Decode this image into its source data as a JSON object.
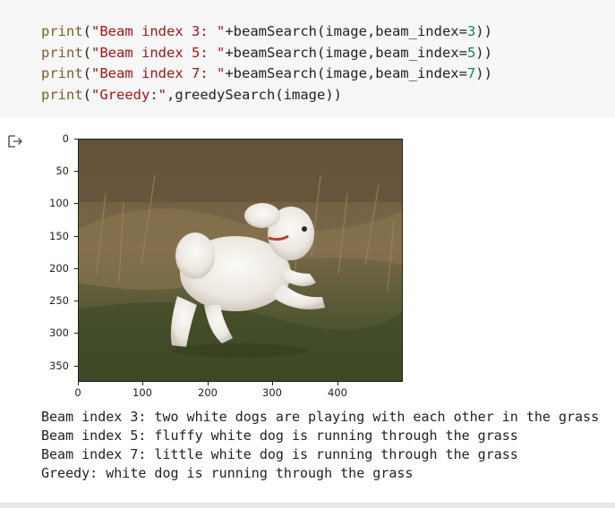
{
  "code": {
    "lines": [
      {
        "fn": "print",
        "open": "(",
        "str": "\"Beam index 3: \"",
        "rest1": "+beamSearch(image,beam_index=",
        "num": "3",
        "close": "))"
      },
      {
        "fn": "print",
        "open": "(",
        "str": "\"Beam index 5: \"",
        "rest1": "+beamSearch(image,beam_index=",
        "num": "5",
        "close": "))"
      },
      {
        "fn": "print",
        "open": "(",
        "str": "\"Beam index 7: \"",
        "rest1": "+beamSearch(image,beam_index=",
        "num": "7",
        "close": "))"
      },
      {
        "fn": "print",
        "open": "(",
        "str": "\"Greedy:\"",
        "rest1": ",greedySearch(image))",
        "num": "",
        "close": ""
      }
    ]
  },
  "plot": {
    "y_ticks": [
      "0",
      "50",
      "100",
      "150",
      "200",
      "250",
      "300",
      "350"
    ],
    "x_ticks": [
      "0",
      "100",
      "200",
      "300",
      "400"
    ]
  },
  "output": {
    "lines": [
      "Beam index 3: two white dogs are playing with each other in the grass",
      "Beam index 5: fluffy white dog is running through the grass",
      "Beam index 7: little white dog is running through the grass",
      "Greedy: white dog is running through the grass"
    ]
  }
}
